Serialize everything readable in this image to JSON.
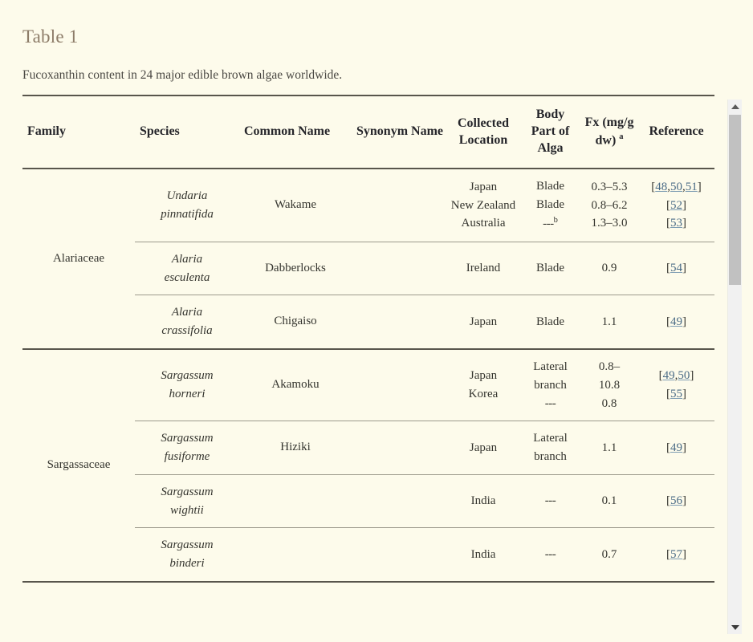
{
  "table": {
    "label": "Table 1",
    "caption": "Fucoxanthin content in 24 major edible brown algae worldwide.",
    "headers": {
      "family": "Family",
      "species": "Species",
      "common_name": "Common Name",
      "synonym_name": "Synonym Name",
      "collected_location": "Collected Location",
      "body_part": "Body Part of Alga",
      "fx": "Fx (mg/g dw)",
      "fx_sup": "a",
      "reference": "Reference"
    },
    "groups": [
      {
        "family": "Alariaceae",
        "rows": [
          {
            "species": "Undaria pinnatifida",
            "common_name": "Wakame",
            "synonym_name": "",
            "locations": [
              "Japan",
              "New Zealand",
              "Australia"
            ],
            "body_parts": [
              "Blade",
              "Blade",
              "---"
            ],
            "body_parts_sup": [
              "",
              "",
              "b"
            ],
            "fx": [
              "0.3–5.3",
              "0.8–6.2",
              "1.3–3.0"
            ],
            "references": [
              {
                "prefix": "[",
                "links": [
                  "48",
                  "50",
                  "51"
                ],
                "suffix": "]"
              },
              {
                "prefix": "[",
                "links": [
                  "52"
                ],
                "suffix": "]"
              },
              {
                "prefix": "[",
                "links": [
                  "53"
                ],
                "suffix": "]"
              }
            ]
          },
          {
            "species": "Alaria esculenta",
            "common_name": "Dabberlocks",
            "synonym_name": "",
            "locations": [
              "Ireland"
            ],
            "body_parts": [
              "Blade"
            ],
            "body_parts_sup": [
              ""
            ],
            "fx": [
              "0.9"
            ],
            "references": [
              {
                "prefix": "[",
                "links": [
                  "54"
                ],
                "suffix": "]"
              }
            ]
          },
          {
            "species": "Alaria crassifolia",
            "common_name": "Chigaiso",
            "synonym_name": "",
            "locations": [
              "Japan"
            ],
            "body_parts": [
              "Blade"
            ],
            "body_parts_sup": [
              ""
            ],
            "fx": [
              "1.1"
            ],
            "references": [
              {
                "prefix": "[",
                "links": [
                  "49"
                ],
                "suffix": "]"
              }
            ]
          }
        ]
      },
      {
        "family": "Sargassaceae",
        "rows": [
          {
            "species": "Sargassum horneri",
            "common_name": "Akamoku",
            "synonym_name": "",
            "locations": [
              "Japan",
              "Korea"
            ],
            "body_parts": [
              "Lateral branch",
              "---"
            ],
            "body_parts_sup": [
              "",
              ""
            ],
            "fx": [
              "0.8–",
              "10.8",
              "0.8"
            ],
            "references": [
              {
                "prefix": "[",
                "links": [
                  "49",
                  "50"
                ],
                "suffix": "]"
              },
              {
                "prefix": "[",
                "links": [
                  "55"
                ],
                "suffix": "]"
              }
            ]
          },
          {
            "species": "Sargassum fusiforme",
            "common_name": "Hiziki",
            "synonym_name": "",
            "locations": [
              "Japan"
            ],
            "body_parts": [
              "Lateral branch"
            ],
            "body_parts_sup": [
              ""
            ],
            "fx": [
              "1.1"
            ],
            "references": [
              {
                "prefix": "[",
                "links": [
                  "49"
                ],
                "suffix": "]"
              }
            ]
          },
          {
            "species": "Sargassum wightii",
            "common_name": "",
            "synonym_name": "",
            "locations": [
              "India"
            ],
            "body_parts": [
              "---"
            ],
            "body_parts_sup": [
              ""
            ],
            "fx": [
              "0.1"
            ],
            "references": [
              {
                "prefix": "[",
                "links": [
                  "56"
                ],
                "suffix": "]"
              }
            ]
          },
          {
            "species": "Sargassum binderi",
            "common_name": "",
            "synonym_name": "",
            "locations": [
              "India"
            ],
            "body_parts": [
              "---"
            ],
            "body_parts_sup": [
              ""
            ],
            "fx": [
              "0.7"
            ],
            "references": [
              {
                "prefix": "[",
                "links": [
                  "57"
                ],
                "suffix": "]"
              }
            ]
          }
        ]
      }
    ]
  },
  "scrollbar": {
    "up_icon": "chevron-up-icon",
    "down_icon": "chevron-down-icon"
  },
  "colors": {
    "page_background": "#fdfbeb",
    "title": "#8d7c68",
    "text": "#35352f",
    "link": "#4a6b86",
    "rule_strong": "#58554c",
    "rule_light": "#9d9a8c",
    "scrollbar_track": "#f1f1f1",
    "scrollbar_thumb": "#c1c1c1"
  }
}
